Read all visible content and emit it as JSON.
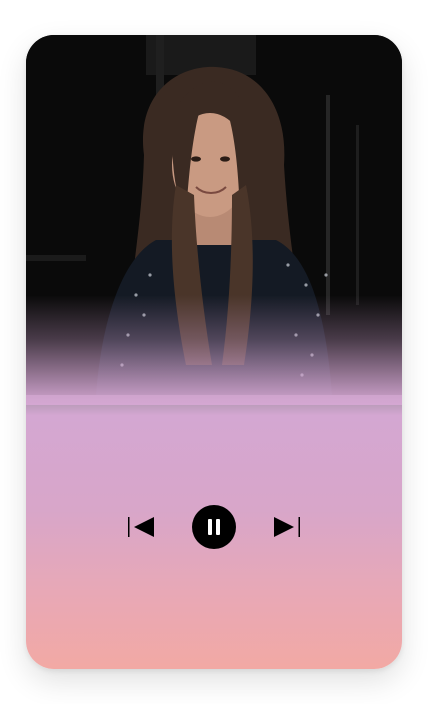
{
  "player": {
    "icons": {
      "previous": "skip-previous-icon",
      "pause": "pause-icon",
      "next": "skip-next-icon"
    },
    "state": "playing",
    "colors": {
      "gradient_top": "#d4a7d2",
      "gradient_bottom": "#f2a9a4",
      "control": "#000000"
    }
  }
}
